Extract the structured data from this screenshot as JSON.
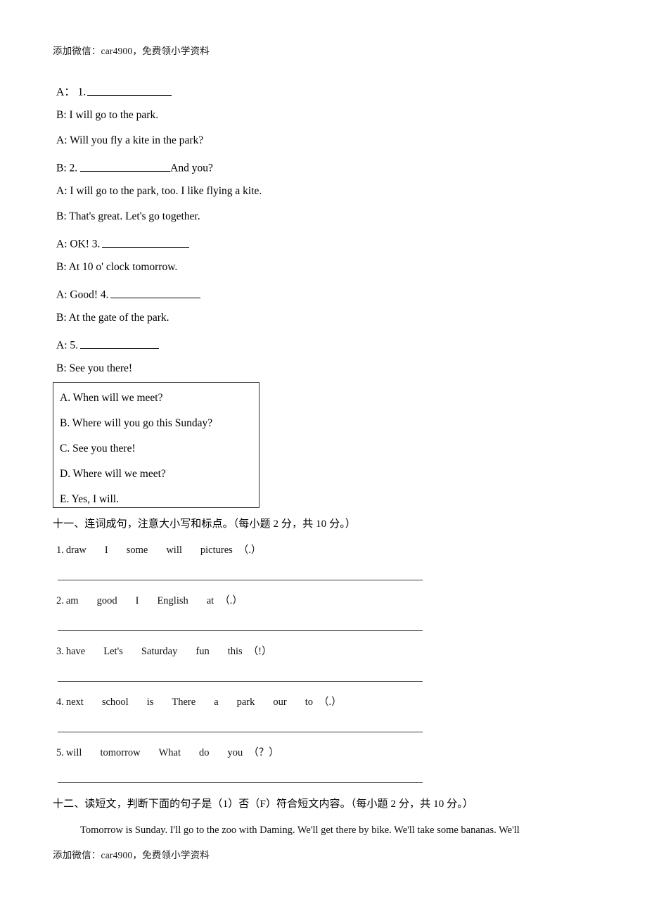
{
  "watermark": {
    "text": "添加微信：car4900，免费领小学资料"
  },
  "dialogue": {
    "lines": [
      {
        "speaker": "A：",
        "pre": "1.",
        "blank": true,
        "post": ""
      },
      {
        "speaker": "B:",
        "pre": "I will go to the park.",
        "blank": false,
        "post": ""
      },
      {
        "speaker": "A:",
        "pre": "Will you fly a kite in the park?",
        "blank": false,
        "post": ""
      },
      {
        "speaker": "B:",
        "pre": "2.",
        "blank": true,
        "post": "And you?"
      },
      {
        "speaker": "A:",
        "pre": "I will go to the park, too. I like flying a kite.",
        "blank": false,
        "post": ""
      },
      {
        "speaker": "B:",
        "pre": "That's great. Let's go together.",
        "blank": false,
        "post": ""
      },
      {
        "speaker": "A:",
        "pre": "OK! 3.",
        "blank": true,
        "post": ""
      },
      {
        "speaker": "B:",
        "pre": "At 10 o' clock tomorrow.",
        "blank": false,
        "post": ""
      },
      {
        "speaker": "A:",
        "pre": "Good! 4.",
        "blank": true,
        "post": ""
      },
      {
        "speaker": "B:",
        "pre": "At the gate of the park.",
        "blank": false,
        "post": ""
      },
      {
        "speaker": "A:",
        "pre": "5.",
        "blank": true,
        "post": ""
      },
      {
        "speaker": "B:",
        "pre": "See you there!",
        "blank": false,
        "post": ""
      }
    ],
    "line_texts": [
      "A：  1.",
      "B: I will go to the park.",
      "A: Will you fly a kite in the park?",
      "B: 2.",
      "A: I will go to the park, too. I like flying a kite.",
      "B: That's great. Let's go together.",
      "A: OK! 3.",
      "B: At 10 o' clock tomorrow.",
      "A: Good! 4.",
      "B: At the gate of the park.",
      "A: 5.",
      "B: See you there!"
    ],
    "and_you": "And you?"
  },
  "options": [
    "A. When will we meet?",
    "B. Where will you go this Sunday?",
    "C. See you there!",
    "D. Where will we meet?",
    "E. Yes, I will."
  ],
  "section_eleven": {
    "heading": "十一、连词成句，注意大小写和标点。（每小题 2 分，共 10 分。）",
    "items": [
      {
        "num": "1.",
        "words": [
          "draw",
          "I",
          "some",
          "will",
          "pictures"
        ],
        "punct": "（.）"
      },
      {
        "num": "2.",
        "words": [
          "am",
          "good",
          "I",
          "English",
          "at"
        ],
        "punct": "（.）"
      },
      {
        "num": "3.",
        "words": [
          "have",
          "Let's",
          "Saturday",
          "fun",
          "this"
        ],
        "punct": "（!）"
      },
      {
        "num": "4.",
        "words": [
          "next",
          "school",
          "is",
          "There",
          "a",
          "park",
          "our",
          "to"
        ],
        "punct": "（.）"
      },
      {
        "num": "5.",
        "words": [
          "will",
          "tomorrow",
          "What",
          "do",
          "you"
        ],
        "punct": "（？）"
      }
    ]
  },
  "section_twelve": {
    "heading": "十二、读短文，判断下面的句子是（1）否（F）符合短文内容。（每小题 2 分，共 10 分。）",
    "passage": "Tomorrow is Sunday. I'll go to the zoo with Daming. We'll get there by bike. We'll take some bananas. We'll"
  }
}
